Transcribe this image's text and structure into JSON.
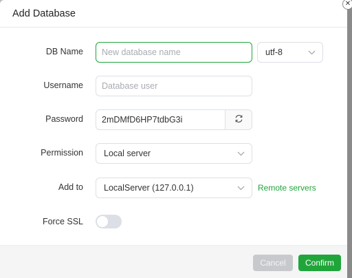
{
  "dialog": {
    "title": "Add Database",
    "close_glyph": "✕"
  },
  "form": {
    "db_name": {
      "label": "DB Name",
      "placeholder": "New database name",
      "value": ""
    },
    "charset": {
      "value": "utf-8",
      "icon": "chevron-down-icon"
    },
    "username": {
      "label": "Username",
      "placeholder": "Database user",
      "value": ""
    },
    "password": {
      "label": "Password",
      "value": "2mDMfD6HP7tdbG3i",
      "icon": "refresh-icon"
    },
    "permission": {
      "label": "Permission",
      "value": "Local server",
      "icon": "chevron-down-icon"
    },
    "add_to": {
      "label": "Add to",
      "value": "LocalServer (127.0.0.1)",
      "icon": "chevron-down-icon",
      "link": "Remote servers"
    },
    "force_ssl": {
      "label": "Force SSL",
      "enabled": false
    }
  },
  "footer": {
    "cancel_label": "Cancel",
    "confirm_label": "Confirm"
  },
  "colors": {
    "accent": "#20a53a",
    "border": "#dcdfe6",
    "placeholder": "#a8abb2",
    "disabled_button": "#c8c9cc"
  }
}
